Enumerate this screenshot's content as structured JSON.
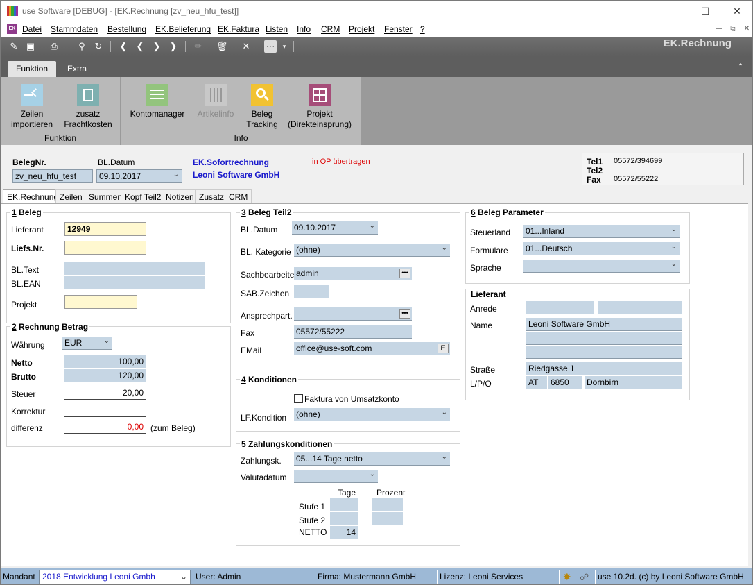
{
  "window": {
    "title": "use Software [DEBUG] - [EK.Rechnung [zv_neu_hfu_test]]"
  },
  "menu": {
    "icon": "EK",
    "items": [
      "Datei",
      "Stammdaten",
      "Bestellung",
      "EK.Belieferung",
      "EK.Faktura",
      "Listen",
      "Info",
      "CRM",
      "Projekt",
      "Fenster",
      "?"
    ]
  },
  "module_title": "EK.Rechnung",
  "ribbon": {
    "tabs": [
      "Funktion",
      "Extra"
    ],
    "buttons": {
      "zeilen": "Zeilen\nimportieren",
      "fracht": "zusatz\nFrachtkosten",
      "konto": "Kontomanager",
      "artikel": "Artikelinfo",
      "tracking": "Beleg\nTracking",
      "projekt": "Projekt\n(Direkteinsprung)"
    },
    "group_funktion": "Funktion",
    "group_info": "Info"
  },
  "header": {
    "belegnr_label": "BelegNr.",
    "belegnr_value": "zv_neu_hfu_test",
    "bldatum_label": "BL.Datum",
    "bldatum_value": "09.10.2017",
    "type": "EK.Sofortrechnung",
    "company": "Leoni Software  GmbH",
    "op_status": "in OP übertragen",
    "tel1_label": "Tel1",
    "tel1_value": "05572/394699",
    "tel2_label": "Tel2",
    "fax_label": "Fax",
    "fax_value": "05572/55222"
  },
  "form_tabs": [
    "EK.Rechnung",
    "Zeilen",
    "Summen",
    "Kopf Teil2",
    "Notizen",
    "Zusatz",
    "CRM"
  ],
  "beleg": {
    "title_num": "1",
    "title": " Beleg",
    "lieferant_label": "Lieferant",
    "lieferant_value": "12949",
    "liefsnr_label": "Liefs.Nr.",
    "bltext_label": "BL.Text",
    "blean_label": "BL.EAN",
    "projekt_label": "Projekt"
  },
  "betrag": {
    "title_num": "2",
    "title": " Rechnung Betrag",
    "waehrung_label": "Währung",
    "waehrung_value": "EUR",
    "netto_label": "Netto",
    "netto_value": "100,00",
    "brutto_label": "Brutto",
    "brutto_value": "120,00",
    "steuer_label": "Steuer",
    "steuer_value": "20,00",
    "korrektur_label": "Korrektur",
    "differenz_label": "differenz",
    "differenz_value": "0,00",
    "zum_beleg": "(zum Beleg)"
  },
  "teil2": {
    "title_num": "3",
    "title": " Beleg Teil2",
    "bldatum_label": "BL.Datum",
    "bldatum_value": "09.10.2017",
    "kategorie_label": "BL. Kategorie",
    "kategorie_value": "(ohne)",
    "sachbearbeiter_label": "Sachbearbeiter",
    "sachbearbeiter_value": "admin",
    "sab_label": "SAB.Zeichen",
    "ansprech_label": "Ansprechpart.",
    "fax_label": "Fax",
    "fax_value": "05572/55222",
    "email_label": "EMail",
    "email_value": "office@use-soft.com",
    "email_btn": "E"
  },
  "konditionen": {
    "title_num": "4",
    "title": " Konditionen",
    "faktura_label": "Faktura von Umsatzkonto",
    "lfkondition_label": "LF.Kondition",
    "lfkondition_value": "(ohne)"
  },
  "zahlung": {
    "title_num": "5",
    "title": " Zahlungskonditionen",
    "zahlungsk_label": "Zahlungsk.",
    "zahlungsk_value": "05...14 Tage netto",
    "valuta_label": "Valutadatum",
    "tage_label": "Tage",
    "prozent_label": "Prozent",
    "stufe1_label": "Stufe 1",
    "stufe2_label": "Stufe 2",
    "netto_label": "NETTO",
    "netto_value": "14"
  },
  "parameter": {
    "title_num": "6",
    "title": " Beleg Parameter",
    "steuerland_label": "Steuerland",
    "steuerland_value": "01...Inland",
    "formulare_label": "Formulare",
    "formulare_value": "01...Deutsch",
    "sprache_label": "Sprache"
  },
  "lieferant": {
    "title": "Lieferant",
    "anrede_label": "Anrede",
    "name_label": "Name",
    "name_value": "Leoni Software  GmbH",
    "strasse_label": "Straße",
    "strasse_value": "Riedgasse 1",
    "lpo_label": "L/P/O",
    "land": "AT",
    "plz": "6850",
    "ort": "Dornbirn"
  },
  "status": {
    "mandant_label": "Mandant",
    "mandant_value": "2018  Entwicklung Leoni Gmbh",
    "user": "User: Admin",
    "firma": "Firma: Mustermann GmbH",
    "lizenz": "Lizenz: Leoni Services",
    "version": "use 10.2d. (c) by Leoni Software GmbH"
  }
}
